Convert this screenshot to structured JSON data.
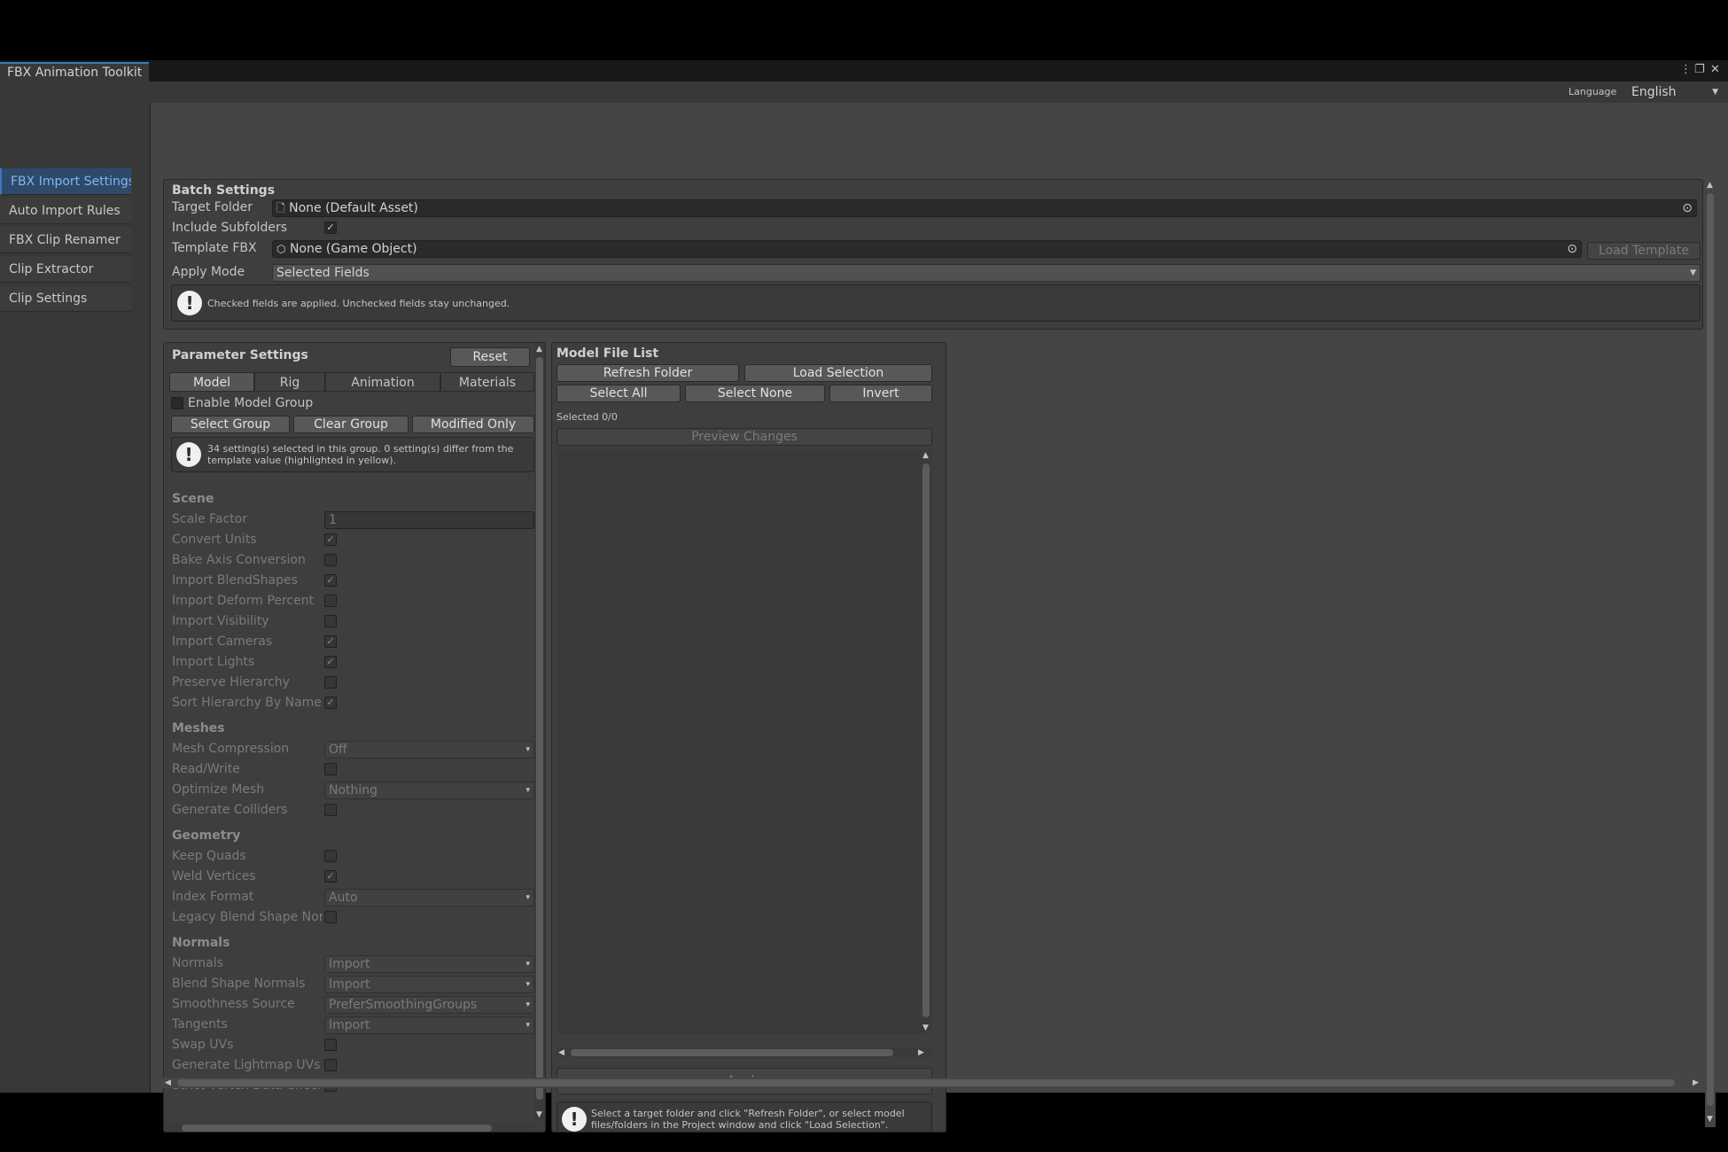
{
  "window": {
    "title": "FBX Animation Toolkit",
    "menu_icon": "kebab-menu-icon",
    "maximize_icon": "maximize-icon",
    "close_icon": "close-icon"
  },
  "language": {
    "label": "Language",
    "value": "English"
  },
  "sidebar": {
    "items": [
      {
        "label": "FBX Import Settings",
        "active": true
      },
      {
        "label": "Auto Import Rules",
        "active": false
      },
      {
        "label": "FBX Clip Renamer",
        "active": false
      },
      {
        "label": "Clip Extractor",
        "active": false
      },
      {
        "label": "Clip Settings",
        "active": false
      }
    ]
  },
  "batch": {
    "title": "Batch Settings",
    "target_folder_label": "Target Folder",
    "target_folder_value": "None (Default Asset)",
    "include_subfolders_label": "Include Subfolders",
    "include_subfolders_checked": true,
    "template_fbx_label": "Template FBX",
    "template_fbx_value": "None (Game Object)",
    "load_template": "Load Template",
    "apply_mode_label": "Apply Mode",
    "apply_mode_value": "Selected Fields",
    "help": "Checked fields are applied. Unchecked fields stay unchanged."
  },
  "params": {
    "title": "Parameter Settings",
    "reset": "Reset",
    "tabs": [
      "Model",
      "Rig",
      "Animation",
      "Materials"
    ],
    "active_tab": "Model",
    "enable_group_label": "Enable Model Group",
    "select_group": "Select Group",
    "clear_group": "Clear Group",
    "modified_only": "Modified Only",
    "help_line1": "34 setting(s) selected in this group. 0 setting(s) differ from the",
    "help_line2": "template value (highlighted in yellow).",
    "scene": {
      "title": "Scene",
      "scale_factor_label": "Scale Factor",
      "scale_factor_value": "1",
      "convert_units": "Convert Units",
      "bake_axis": "Bake Axis Conversion",
      "import_blendshapes": "Import BlendShapes",
      "import_deform": "Import Deform Percent",
      "import_visibility": "Import Visibility",
      "import_cameras": "Import Cameras",
      "import_lights": "Import Lights",
      "preserve_hierarchy": "Preserve Hierarchy",
      "sort_hierarchy": "Sort Hierarchy By Name"
    },
    "meshes": {
      "title": "Meshes",
      "mesh_compression_label": "Mesh Compression",
      "mesh_compression_value": "Off",
      "read_write": "Read/Write",
      "optimize_mesh_label": "Optimize Mesh",
      "optimize_mesh_value": "Nothing",
      "generate_colliders": "Generate Colliders"
    },
    "geometry": {
      "title": "Geometry",
      "keep_quads": "Keep Quads",
      "weld_vertices": "Weld Vertices",
      "index_format_label": "Index Format",
      "index_format_value": "Auto",
      "legacy_blend": "Legacy Blend Shape Nor"
    },
    "normals": {
      "title": "Normals",
      "normals_label": "Normals",
      "normals_value": "Import",
      "blend_normals_label": "Blend Shape Normals",
      "blend_normals_value": "Import",
      "smoothness_label": "Smoothness Source",
      "smoothness_value": "PreferSmoothingGroups",
      "tangents_label": "Tangents",
      "tangents_value": "Import",
      "swap_uvs": "Swap UVs",
      "lightmap_uvs": "Generate Lightmap UVs",
      "strict_vertex": "Strict Vertex Data Checks"
    }
  },
  "files": {
    "title": "Model File List",
    "refresh": "Refresh Folder",
    "load_selection": "Load Selection",
    "select_all": "Select All",
    "select_none": "Select None",
    "invert": "Invert",
    "selected": "Selected 0/0",
    "preview": "Preview Changes",
    "apply": "Apply",
    "help_line1": "Select a target folder and click \"Refresh Folder\", or select model",
    "help_line2": "files/folders in the Project window and click \"Load Selection\"."
  }
}
